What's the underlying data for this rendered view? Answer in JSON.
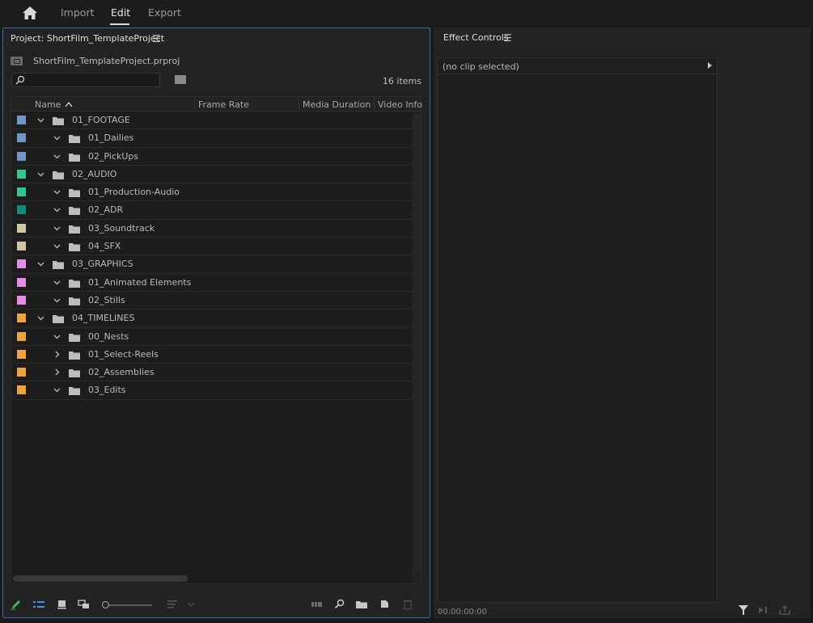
{
  "top_nav": {
    "tabs": [
      {
        "label": "Import",
        "active": false
      },
      {
        "label": "Edit",
        "active": true
      },
      {
        "label": "Export",
        "active": false
      }
    ]
  },
  "project_panel": {
    "title": "Project: ShortFilm_TemplateProject",
    "project_file": "ShortFilm_TemplateProject.prproj",
    "search_placeholder": "",
    "item_count": "16 items",
    "columns": [
      "Name",
      "Frame Rate",
      "Media Duration",
      "Video Info"
    ],
    "rows": [
      {
        "label": "01_FOOTAGE",
        "level": 0,
        "expanded": true,
        "color": "#6f95c9"
      },
      {
        "label": "01_Dailies",
        "level": 1,
        "expanded": true,
        "color": "#6f95c9"
      },
      {
        "label": "02_PickUps",
        "level": 1,
        "expanded": true,
        "color": "#6f95c9"
      },
      {
        "label": "02_AUDIO",
        "level": 0,
        "expanded": true,
        "color": "#2fc88e"
      },
      {
        "label": "01_Production-Audio",
        "level": 1,
        "expanded": true,
        "color": "#2fc88e"
      },
      {
        "label": "02_ADR",
        "level": 1,
        "expanded": true,
        "color": "#0f8a78"
      },
      {
        "label": "03_Soundtrack",
        "level": 1,
        "expanded": true,
        "color": "#d2c6a0"
      },
      {
        "label": "04_SFX",
        "level": 1,
        "expanded": true,
        "color": "#d2c6a0"
      },
      {
        "label": "03_GRAPHICS",
        "level": 0,
        "expanded": true,
        "color": "#e48ee4"
      },
      {
        "label": "01_Animated Elements",
        "level": 1,
        "expanded": true,
        "color": "#e48ee4"
      },
      {
        "label": "02_Stills",
        "level": 1,
        "expanded": true,
        "color": "#e48ee4"
      },
      {
        "label": "04_TIMELINES",
        "level": 0,
        "expanded": true,
        "color": "#eea43c"
      },
      {
        "label": "00_Nests",
        "level": 1,
        "expanded": true,
        "color": "#eea43c"
      },
      {
        "label": "01_Select-Reels",
        "level": 1,
        "expanded": false,
        "color": "#eea43c"
      },
      {
        "label": "02_Assemblies",
        "level": 1,
        "expanded": false,
        "color": "#eea43c"
      },
      {
        "label": "03_Edits",
        "level": 1,
        "expanded": true,
        "color": "#eea43c"
      }
    ]
  },
  "effect_controls": {
    "title": "Effect Controls",
    "no_clip_text": "(no clip selected)",
    "timecode": "00:00:00:00"
  },
  "colors": {
    "accent_border": "#3b6db0",
    "pencil_green": "#3fbf5a",
    "list_view_blue": "#4d8fe6"
  }
}
